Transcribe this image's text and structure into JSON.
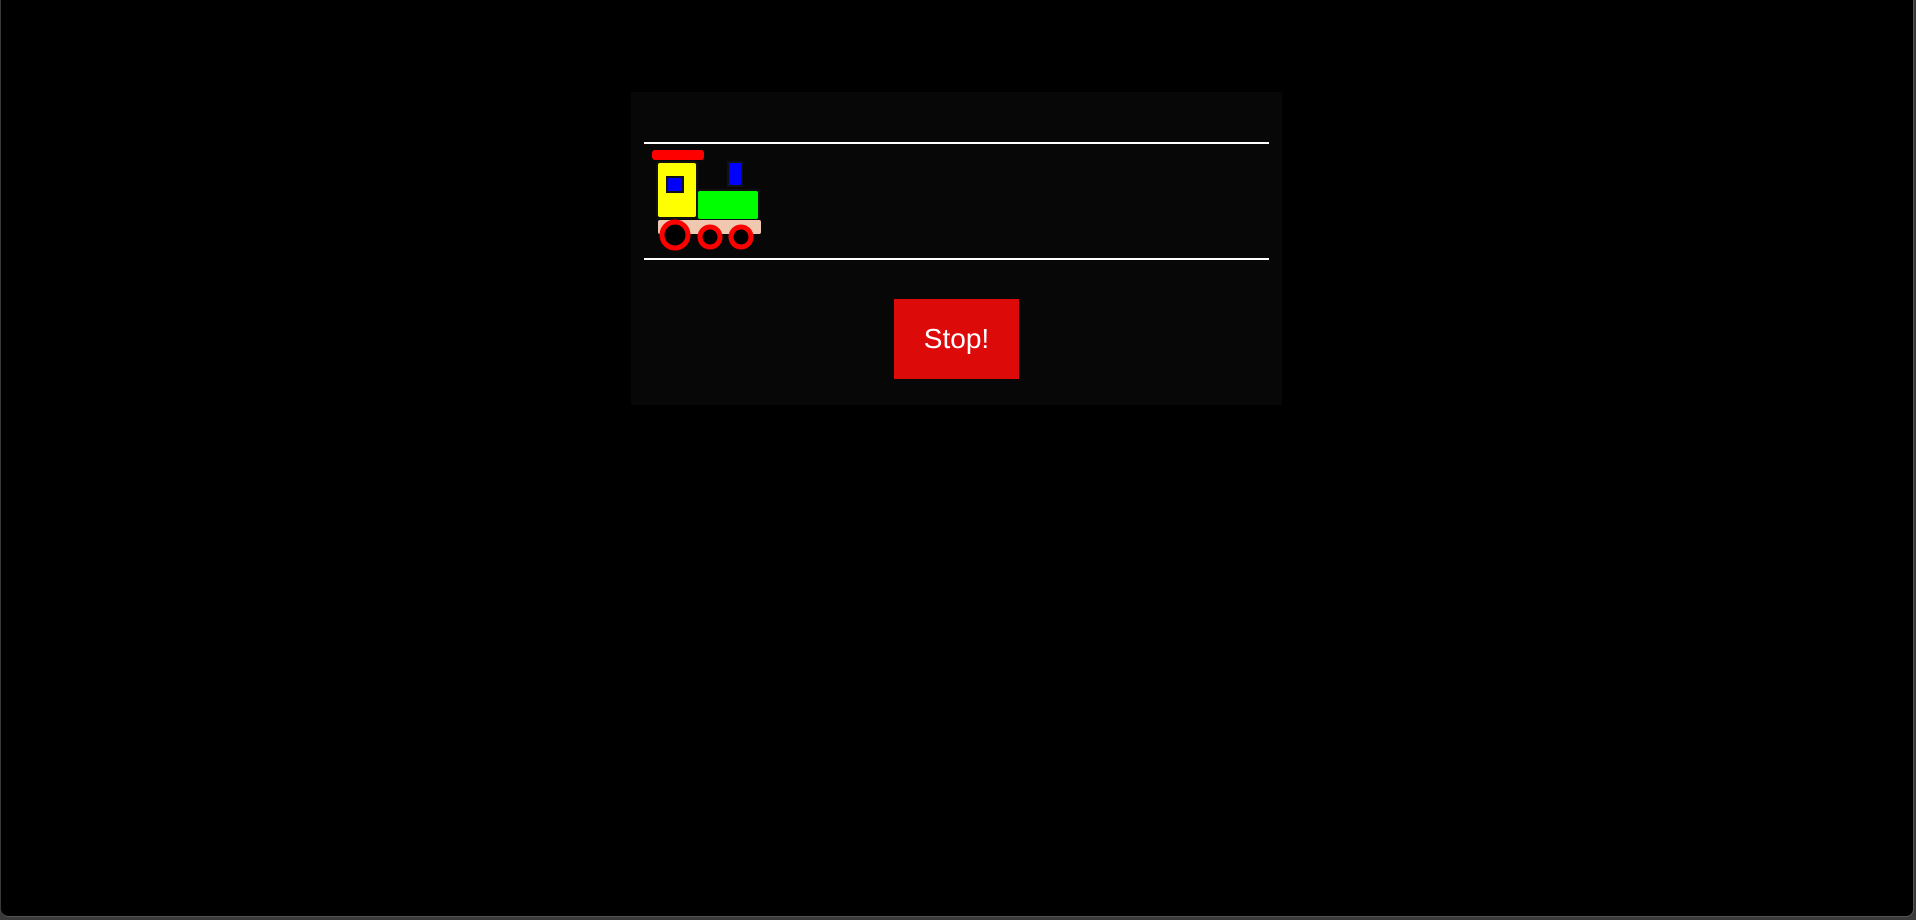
{
  "controls": {
    "stop_label": "Stop!"
  },
  "icons": {
    "train": "train-icon"
  },
  "colors": {
    "page_background": "#000000",
    "panel_background": "#070707",
    "track_lines": "#ffffff",
    "stop_button": "#dd0a0a",
    "train_cab": "#ffff00",
    "train_boiler": "#00ff00",
    "train_roof": "#ff0000",
    "train_window": "#0000ff",
    "train_wheels": "#ff0000"
  }
}
